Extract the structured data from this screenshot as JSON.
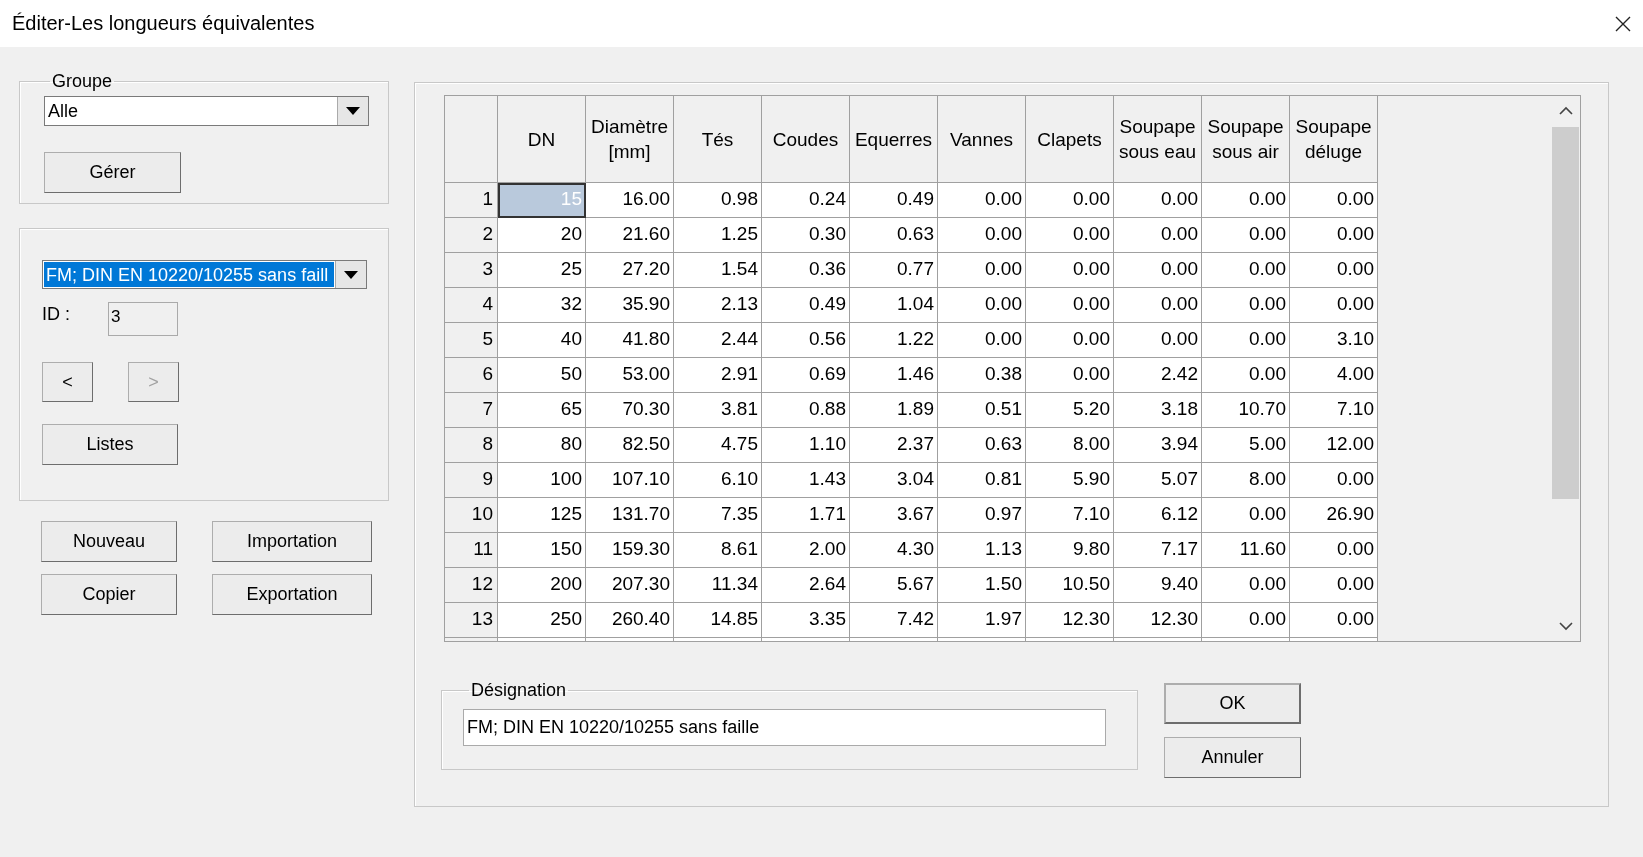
{
  "window": {
    "title": "Éditer-Les longueurs équivalentes"
  },
  "groupe": {
    "legend": "Groupe",
    "value": "Alle",
    "button": "Gérer"
  },
  "record": {
    "value": "FM; DIN EN 10220/10255 sans faill",
    "value_selected": true,
    "id_label": "ID :",
    "id": "3",
    "prev": {
      "label": "<",
      "disabled": false
    },
    "next": {
      "label": ">",
      "disabled": true
    },
    "lists_button": "Listes"
  },
  "buttons": [
    {
      "label": "Nouveau"
    },
    {
      "label": "Importation"
    },
    {
      "label": "Copier"
    },
    {
      "label": "Exportation"
    }
  ],
  "table": {
    "columns": [
      "DN",
      "Diamètre\n[mm]",
      "Tés",
      "Coudes",
      "Equerres",
      "Vannes",
      "Clapets",
      "Soupape\nsous eau",
      "Soupape\nsous air",
      "Soupape\ndéluge"
    ],
    "rows": [
      {
        "num": "1",
        "selected": true,
        "cells": [
          "15",
          "16.00",
          "0.98",
          "0.24",
          "0.49",
          "0.00",
          "0.00",
          "0.00",
          "0.00",
          "0.00"
        ]
      },
      {
        "num": "2",
        "selected": false,
        "cells": [
          "20",
          "21.60",
          "1.25",
          "0.30",
          "0.63",
          "0.00",
          "0.00",
          "0.00",
          "0.00",
          "0.00"
        ]
      },
      {
        "num": "3",
        "selected": false,
        "cells": [
          "25",
          "27.20",
          "1.54",
          "0.36",
          "0.77",
          "0.00",
          "0.00",
          "0.00",
          "0.00",
          "0.00"
        ]
      },
      {
        "num": "4",
        "selected": false,
        "cells": [
          "32",
          "35.90",
          "2.13",
          "0.49",
          "1.04",
          "0.00",
          "0.00",
          "0.00",
          "0.00",
          "0.00"
        ]
      },
      {
        "num": "5",
        "selected": false,
        "cells": [
          "40",
          "41.80",
          "2.44",
          "0.56",
          "1.22",
          "0.00",
          "0.00",
          "0.00",
          "0.00",
          "3.10"
        ]
      },
      {
        "num": "6",
        "selected": false,
        "cells": [
          "50",
          "53.00",
          "2.91",
          "0.69",
          "1.46",
          "0.38",
          "0.00",
          "2.42",
          "0.00",
          "4.00"
        ]
      },
      {
        "num": "7",
        "selected": false,
        "cells": [
          "65",
          "70.30",
          "3.81",
          "0.88",
          "1.89",
          "0.51",
          "5.20",
          "3.18",
          "10.70",
          "7.10"
        ]
      },
      {
        "num": "8",
        "selected": false,
        "cells": [
          "80",
          "82.50",
          "4.75",
          "1.10",
          "2.37",
          "0.63",
          "8.00",
          "3.94",
          "5.00",
          "12.00"
        ]
      },
      {
        "num": "9",
        "selected": false,
        "cells": [
          "100",
          "107.10",
          "6.10",
          "1.43",
          "3.04",
          "0.81",
          "5.90",
          "5.07",
          "8.00",
          "0.00"
        ]
      },
      {
        "num": "10",
        "selected": false,
        "cells": [
          "125",
          "131.70",
          "7.35",
          "1.71",
          "3.67",
          "0.97",
          "7.10",
          "6.12",
          "0.00",
          "26.90"
        ]
      },
      {
        "num": "11",
        "selected": false,
        "cells": [
          "150",
          "159.30",
          "8.61",
          "2.00",
          "4.30",
          "1.13",
          "9.80",
          "7.17",
          "11.60",
          "0.00"
        ]
      },
      {
        "num": "12",
        "selected": false,
        "cells": [
          "200",
          "207.30",
          "11.34",
          "2.64",
          "5.67",
          "1.50",
          "10.50",
          "9.40",
          "0.00",
          "0.00"
        ]
      },
      {
        "num": "13",
        "selected": false,
        "cells": [
          "250",
          "260.40",
          "14.85",
          "3.35",
          "7.42",
          "1.97",
          "12.30",
          "12.30",
          "0.00",
          "0.00"
        ]
      }
    ]
  },
  "designation": {
    "legend": "Désignation",
    "value": "FM; DIN EN 10220/10255 sans faille"
  },
  "dialog_buttons": [
    {
      "label": "OK",
      "default": true
    },
    {
      "label": "Annuler",
      "default": false
    }
  ]
}
